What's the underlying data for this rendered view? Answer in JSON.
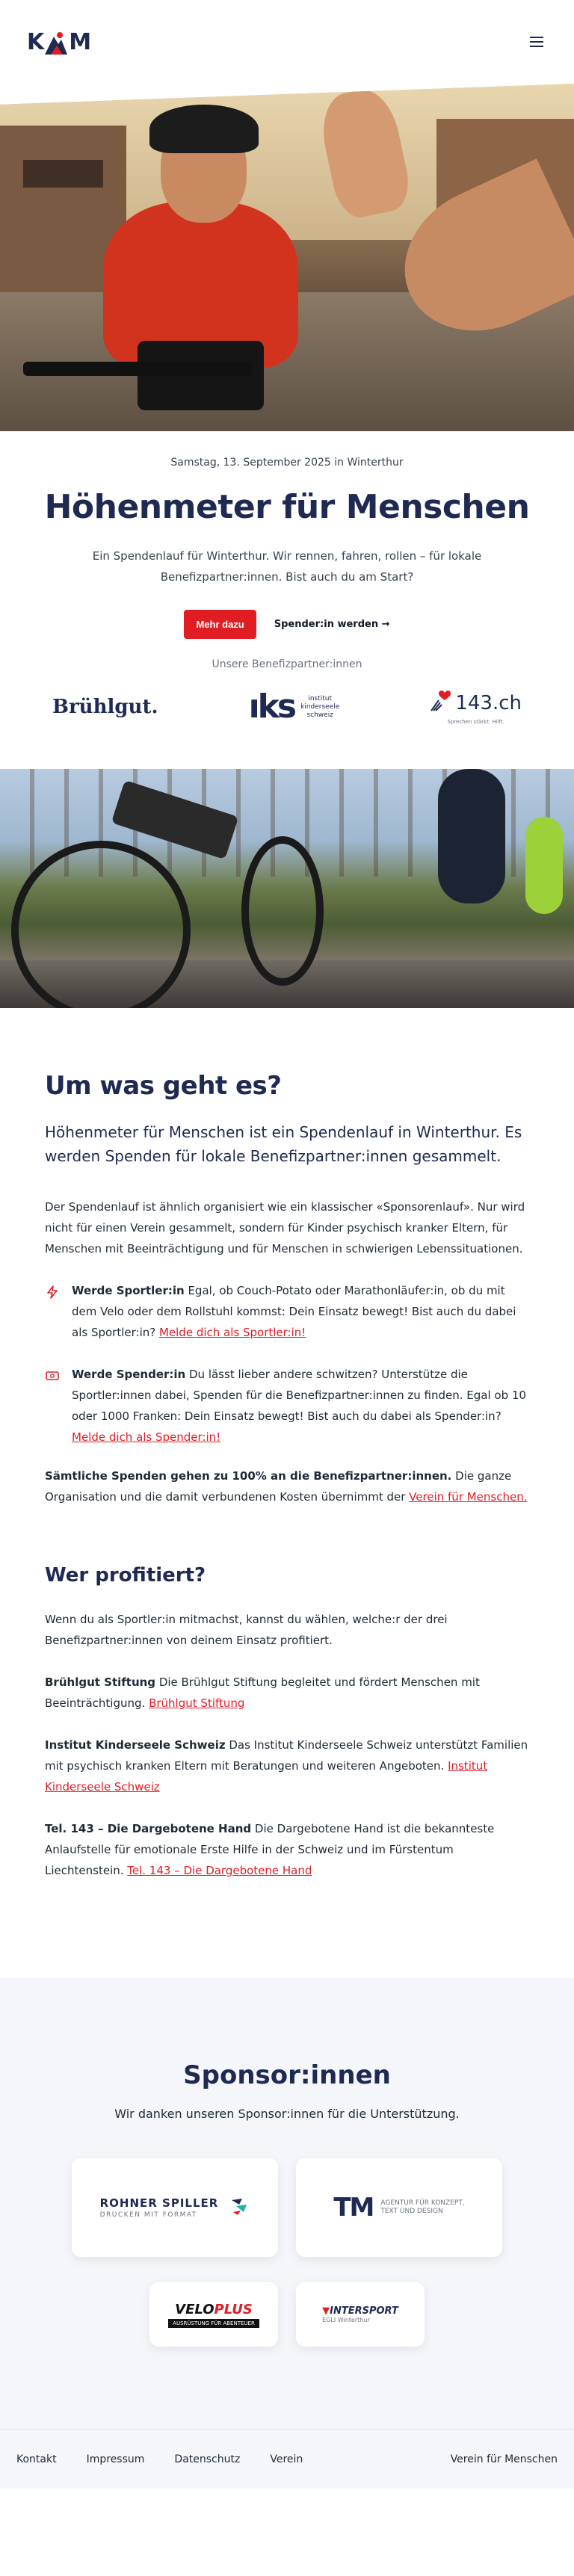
{
  "header": {
    "logo_text_left": "K",
    "logo_text_right": "M",
    "menu_icon": "hamburger-icon"
  },
  "hero": {
    "date": "Samstag, 13. September 2025 in Winterthur",
    "title": "Höhenmeter für Menschen",
    "lead": "Ein Spendenlauf für Winterthur. Wir rennen, fahren, rollen – für lokale Benefizpartner:innen. Bist auch du am Start?",
    "primary_button": "Mehr dazu",
    "secondary_link": "Spender:in werden →",
    "partners_label": "Unsere Benefizpartner:innen"
  },
  "partner_logos": {
    "bruehlgut": "Brühlgut.",
    "iks_mark": "ıks",
    "iks_text": [
      "institut",
      "kinderseele",
      "schweiz"
    ],
    "tel143_main": "143.ch",
    "tel143_sub": "Sprechen stärkt. Hilft."
  },
  "info": {
    "heading": "Um was geht es?",
    "intro": "Höhenmeter für Menschen ist ein Spendenlauf in Winterthur. Es werden Spenden für lokale Benefizpartner:innen gesammelt.",
    "body": "Der Spendenlauf ist ähnlich organisiert wie ein klassischer «Sponsorenlauf». Nur wird nicht für einen Verein gesammelt, sondern für Kinder psychisch kranker Eltern, für Menschen mit Beeinträchtigung und für Menschen in schwierigen Lebenssituationen.",
    "feature_athlete": {
      "title": "Werde Sportler:in",
      "text": " Egal, ob Couch-Potato oder Marathonläufer:in, ob du mit dem Velo oder dem Rollstuhl kommst: Dein Einsatz bewegt! Bist auch du dabei als Sportler:in? ",
      "link": "Melde dich als Sportler:in!"
    },
    "feature_donor": {
      "title": "Werde Spender:in",
      "text": " Du lässt lieber andere schwitzen? Unterstütze die Sportler:innen dabei, Spenden für die Benefizpartner:innen zu finden. Egal ob 10 oder 1000 Franken: Dein Einsatz bewegt! Bist auch du dabei als Spender:in? ",
      "link": "Melde dich als Spender:in!"
    },
    "note_bold": "Sämtliche Spenden gehen zu 100% an die Benefizpartner:innen.",
    "note_text": " Die ganze Organisation und die damit verbundenen Kosten übernimmt der ",
    "note_link": "Verein für Menschen.",
    "benef_heading": "Wer profitiert?",
    "benef_intro": "Wenn du als Sportler:in mitmachst, kannst du wählen, welche:r der drei Benefizpartner:innen von deinem Einsatz profitiert.",
    "benef_1": {
      "name": "Brühlgut Stiftung",
      "text": " Die Brühlgut Stiftung begleitet und fördert Menschen mit Beeinträchtigung. ",
      "link": "Brühlgut Stiftung"
    },
    "benef_2": {
      "name": "Institut Kinderseele Schweiz",
      "text": " Das Institut Kinderseele Schweiz unterstützt Familien mit psychisch kranken Eltern mit Beratungen und weiteren Angeboten. ",
      "link": "Institut Kinderseele Schweiz"
    },
    "benef_3": {
      "name": "Tel. 143 – Die Dargebotene Hand",
      "text": " Die Dargebotene Hand ist die bekannteste Anlaufstelle für emotionale Erste Hilfe in der Schweiz und im Fürstentum Liechtenstein. ",
      "link": "Tel. 143 – Die Dargebotene Hand"
    }
  },
  "sponsors": {
    "heading": "Sponsor:innen",
    "sub": "Wir danken unseren Sponsor:innen für die Unterstützung.",
    "rohner_name": "ROHNER SPILLER",
    "rohner_tag": "DRUCKEN MIT FORMAT",
    "tm_mark": "TM",
    "tm_text": [
      "AGENTUR FÜR KONZEPT,",
      "TEXT UND DESIGN"
    ],
    "veloplus_a": "VELO",
    "veloplus_b": "PLUS",
    "veloplus_tag": "AUSRÜSTUNG FÜR ABENTEUER",
    "intersport_a": "▼",
    "intersport_b": "INTERSPORT",
    "intersport_sub": "EGLI Winterthur"
  },
  "footer": {
    "links": [
      "Kontakt",
      "Impressum",
      "Datenschutz",
      "Verein"
    ],
    "right": "Verein für Menschen"
  },
  "colors": {
    "accent": "#e11d24",
    "navy": "#1e2a52",
    "sponsor_bg": "#f4f6f9"
  }
}
